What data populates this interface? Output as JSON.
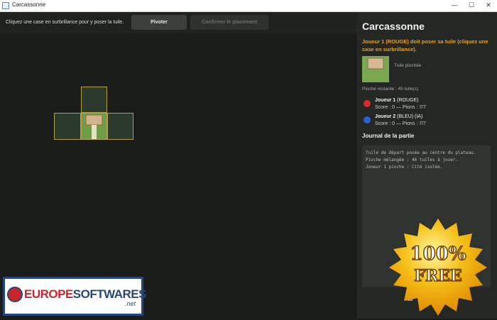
{
  "window": {
    "title": "Carcassonne",
    "minimize_glyph": "—",
    "maximize_glyph": "☐",
    "close_glyph": "✕"
  },
  "toolbar": {
    "hint": "Cliquez une case en surbrillance pour y poser la tuile.",
    "rotate_label": "Pivoter",
    "confirm_label": "Confirmer le placement"
  },
  "panel": {
    "title": "Carcassonne",
    "turn_message": "Joueur 1 (ROUGE) doit poser sa tuile (cliquez une case en surbrillance).",
    "drawn_tile_label": "Tuile piochée",
    "deck_remaining": "Pioche restante : 45 tuile(s)",
    "players": [
      {
        "name": "Joueur 1",
        "detail": "(ROUGE)",
        "score_line": "Score : 0 — Pions : 7/7",
        "color": "#d92b2b"
      },
      {
        "name": "Joueur 2",
        "detail": "(BLEU) (IA)",
        "score_line": "Score : 0 — Pions : 7/7",
        "color": "#2563d6"
      }
    ],
    "journal_title": "Journal de la partie",
    "journal": [
      "Tuile de départ posée au centre du plateau.",
      "Pioche mélangée : 46 tuiles à jouer.",
      "Joueur 1 pioche : Cité isolée."
    ],
    "new_game_label": "No"
  },
  "watermark": {
    "logo_left": "EUROPE",
    "logo_right": "SOFTWARES",
    "logo_suffix": ".net",
    "badge_top": "100%",
    "badge_bottom": "FREE"
  },
  "colors": {
    "accent": "#e8a21d",
    "board": "#1b1d1a",
    "panel": "#242724",
    "highlight": "#b39f45"
  },
  "icons": [
    "app-icon",
    "minimize-icon",
    "maximize-icon",
    "close-icon",
    "player-red-dot-icon",
    "player-blue-dot-icon"
  ]
}
